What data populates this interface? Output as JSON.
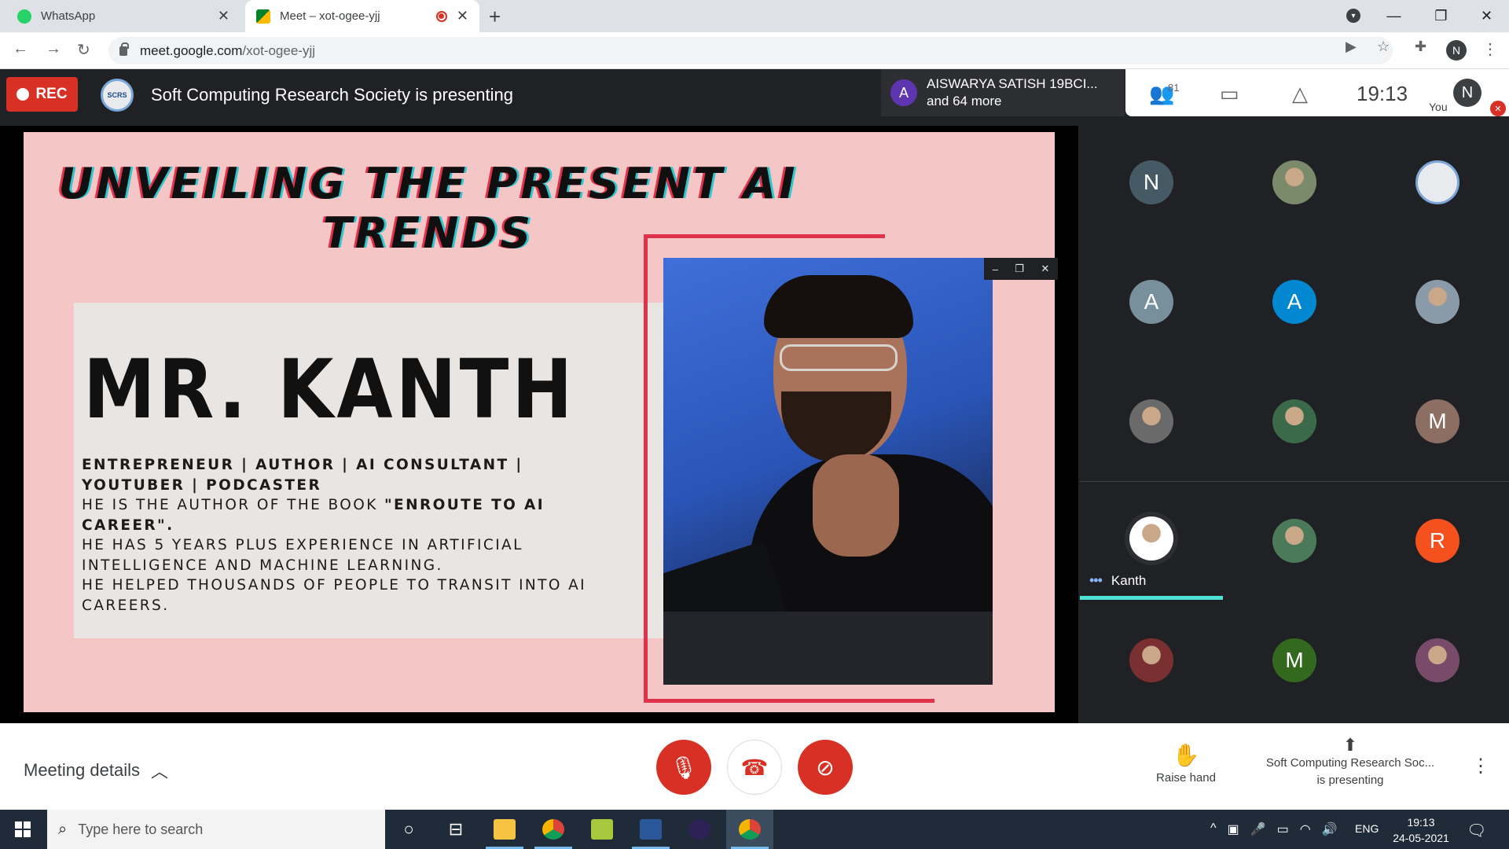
{
  "browser": {
    "tabs": [
      {
        "title": "WhatsApp"
      },
      {
        "title": "Meet – xot-ogee-yjj"
      }
    ],
    "url_host": "meet.google.com",
    "url_path": "/xot-ogee-yjj",
    "profile_initial": "N"
  },
  "meet_top": {
    "rec_label": "REC",
    "presenting_text": "Soft Computing Research Society is presenting",
    "joiner_initial": "A",
    "joiner_name": "AISWARYA SATISH 19BCI...",
    "joiner_more": "and 64 more",
    "participant_count": "81",
    "clock": "19:13",
    "you_label": "You",
    "you_initial": "N"
  },
  "slide": {
    "title": "UNVEILING THE PRESENT AI TRENDS",
    "speaker": "MR. KANTH",
    "bio_line1": "ENTREPRENEUR | AUTHOR | AI CONSULTANT | YOUTUBER | PODCASTER",
    "bio_line2_pre": "HE IS THE AUTHOR OF THE BOOK ",
    "bio_line2_book": "\"ENROUTE TO AI CAREER\".",
    "bio_line3": "HE HAS 5 YEARS PLUS EXPERIENCE IN ARTIFICIAL INTELLIGENCE AND MACHINE LEARNING.",
    "bio_line4": "HE HELPED THOUSANDS OF PEOPLE TO TRANSIT INTO AI CAREERS."
  },
  "participants": [
    {
      "initial": "N",
      "color": "#455a64",
      "kind": "letter"
    },
    {
      "initial": "",
      "color": "#7a8a6a",
      "kind": "photo"
    },
    {
      "initial": "",
      "color": "#e8eaed",
      "kind": "logo"
    },
    {
      "initial": "A",
      "color": "#78909c",
      "kind": "letter"
    },
    {
      "initial": "A",
      "color": "#0288d1",
      "kind": "letter"
    },
    {
      "initial": "",
      "color": "#8a9aa8",
      "kind": "photo"
    },
    {
      "initial": "",
      "color": "#6a6a6a",
      "kind": "photo"
    },
    {
      "initial": "",
      "color": "#3a6a4a",
      "kind": "photo"
    },
    {
      "initial": "M",
      "color": "#8d6e63",
      "kind": "letter"
    },
    {
      "initial": "",
      "color": "#ffffff",
      "kind": "photo"
    },
    {
      "initial": "",
      "color": "#4a7a5a",
      "kind": "photo"
    },
    {
      "initial": "R",
      "color": "#f4511e",
      "kind": "letter"
    },
    {
      "initial": "",
      "color": "#7a3030",
      "kind": "photo"
    },
    {
      "initial": "M",
      "color": "#33691e",
      "kind": "letter"
    },
    {
      "initial": "",
      "color": "#7a4a6a",
      "kind": "photo"
    }
  ],
  "active_speaker": "Kanth",
  "bottom": {
    "meeting_details": "Meeting details",
    "raise_hand": "Raise hand",
    "presenting_line1": "Soft Computing Research Soc...",
    "presenting_line2": "is presenting"
  },
  "taskbar": {
    "search_placeholder": "Type here to search",
    "lang": "ENG",
    "time": "19:13",
    "date": "24-05-2021"
  }
}
